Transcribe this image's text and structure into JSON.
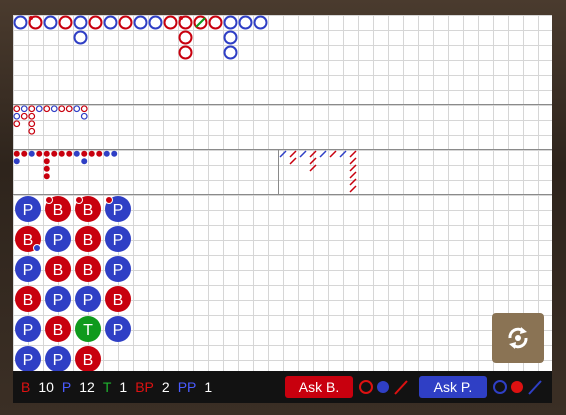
{
  "colors": {
    "banker": "#c8000e",
    "player": "#2f3fc5",
    "tie": "#0f9a1d",
    "grid": "#d6d6d6",
    "divider": "#8a8a8a"
  },
  "bead_plate": {
    "columns": [
      [
        "P",
        "B",
        "P",
        "B",
        "P",
        "P"
      ],
      [
        "B",
        "P",
        "B",
        "P",
        "B",
        "P"
      ],
      [
        "B",
        "B",
        "B",
        "P",
        "T",
        "B"
      ],
      [
        "P",
        "P",
        "P",
        "B",
        "P",
        null
      ]
    ],
    "markers": [
      {
        "col": 1,
        "row": 0,
        "type": "banker-pair"
      },
      {
        "col": 2,
        "row": 0,
        "type": "banker-pair"
      },
      {
        "col": 3,
        "row": 0,
        "type": "banker-pair"
      },
      {
        "col": 0,
        "row": 1,
        "type": "player-pair"
      }
    ]
  },
  "big_road": {
    "entries": [
      {
        "col": 0,
        "row": 0,
        "c": "P"
      },
      {
        "col": 1,
        "row": 0,
        "c": "B"
      },
      {
        "col": 2,
        "row": 0,
        "c": "P"
      },
      {
        "col": 3,
        "row": 0,
        "c": "B"
      },
      {
        "col": 4,
        "row": 0,
        "c": "P"
      },
      {
        "col": 4,
        "row": 1,
        "c": "P"
      },
      {
        "col": 5,
        "row": 0,
        "c": "B"
      },
      {
        "col": 6,
        "row": 0,
        "c": "P"
      },
      {
        "col": 7,
        "row": 0,
        "c": "B"
      },
      {
        "col": 8,
        "row": 0,
        "c": "P"
      },
      {
        "col": 9,
        "row": 0,
        "c": "P"
      },
      {
        "col": 10,
        "row": 0,
        "c": "B"
      },
      {
        "col": 11,
        "row": 0,
        "c": "B"
      },
      {
        "col": 11,
        "row": 1,
        "c": "B"
      },
      {
        "col": 11,
        "row": 2,
        "c": "B"
      },
      {
        "col": 12,
        "row": 0,
        "c": "B"
      },
      {
        "col": 13,
        "row": 0,
        "c": "B"
      },
      {
        "col": 14,
        "row": 0,
        "c": "P"
      },
      {
        "col": 14,
        "row": 1,
        "c": "P"
      },
      {
        "col": 14,
        "row": 2,
        "c": "P"
      },
      {
        "col": 15,
        "row": 0,
        "c": "P"
      },
      {
        "col": 16,
        "row": 0,
        "c": "P"
      }
    ],
    "ties": [
      {
        "col": 12,
        "row": 0
      }
    ],
    "markers": [
      {
        "col": 1,
        "row": 0,
        "type": "banker-pair"
      },
      {
        "col": 11,
        "row": 0,
        "type": "banker-pair"
      }
    ]
  },
  "big_eye_road": {
    "entries": [
      {
        "col": 0,
        "row": 0,
        "c": "B"
      },
      {
        "col": 0,
        "row": 1,
        "c": "P"
      },
      {
        "col": 0,
        "row": 2,
        "c": "B"
      },
      {
        "col": 1,
        "row": 0,
        "c": "P"
      },
      {
        "col": 1,
        "row": 1,
        "c": "B"
      },
      {
        "col": 2,
        "row": 0,
        "c": "B"
      },
      {
        "col": 2,
        "row": 1,
        "c": "B"
      },
      {
        "col": 2,
        "row": 2,
        "c": "B"
      },
      {
        "col": 2,
        "row": 3,
        "c": "B"
      },
      {
        "col": 3,
        "row": 0,
        "c": "P"
      },
      {
        "col": 4,
        "row": 0,
        "c": "B"
      },
      {
        "col": 5,
        "row": 0,
        "c": "P"
      },
      {
        "col": 6,
        "row": 0,
        "c": "B"
      },
      {
        "col": 7,
        "row": 0,
        "c": "B"
      },
      {
        "col": 8,
        "row": 0,
        "c": "P"
      },
      {
        "col": 9,
        "row": 0,
        "c": "B"
      },
      {
        "col": 9,
        "row": 1,
        "c": "P"
      }
    ]
  },
  "small_road": {
    "entries": [
      {
        "col": 0,
        "row": 0,
        "c": "B"
      },
      {
        "col": 0,
        "row": 1,
        "c": "P"
      },
      {
        "col": 1,
        "row": 0,
        "c": "B"
      },
      {
        "col": 2,
        "row": 0,
        "c": "P"
      },
      {
        "col": 3,
        "row": 0,
        "c": "B"
      },
      {
        "col": 4,
        "row": 0,
        "c": "B"
      },
      {
        "col": 4,
        "row": 1,
        "c": "B"
      },
      {
        "col": 4,
        "row": 2,
        "c": "B"
      },
      {
        "col": 4,
        "row": 3,
        "c": "B"
      },
      {
        "col": 5,
        "row": 0,
        "c": "B"
      },
      {
        "col": 6,
        "row": 0,
        "c": "B"
      },
      {
        "col": 7,
        "row": 0,
        "c": "B"
      },
      {
        "col": 8,
        "row": 0,
        "c": "P"
      },
      {
        "col": 9,
        "row": 0,
        "c": "B"
      },
      {
        "col": 9,
        "row": 1,
        "c": "P"
      },
      {
        "col": 10,
        "row": 0,
        "c": "B"
      },
      {
        "col": 11,
        "row": 0,
        "c": "B"
      },
      {
        "col": 12,
        "row": 0,
        "c": "P"
      },
      {
        "col": 13,
        "row": 0,
        "c": "P"
      }
    ]
  },
  "cockroach_road": {
    "entries": [
      {
        "col": 0,
        "row": 0,
        "c": "P"
      },
      {
        "col": 1,
        "row": 0,
        "c": "B"
      },
      {
        "col": 1,
        "row": 1,
        "c": "B"
      },
      {
        "col": 2,
        "row": 0,
        "c": "P"
      },
      {
        "col": 3,
        "row": 0,
        "c": "B"
      },
      {
        "col": 3,
        "row": 1,
        "c": "B"
      },
      {
        "col": 3,
        "row": 2,
        "c": "B"
      },
      {
        "col": 4,
        "row": 0,
        "c": "P"
      },
      {
        "col": 5,
        "row": 0,
        "c": "B"
      },
      {
        "col": 6,
        "row": 0,
        "c": "P"
      },
      {
        "col": 7,
        "row": 0,
        "c": "B"
      },
      {
        "col": 7,
        "row": 1,
        "c": "B"
      },
      {
        "col": 7,
        "row": 2,
        "c": "B"
      },
      {
        "col": 7,
        "row": 3,
        "c": "B"
      },
      {
        "col": 7,
        "row": 4,
        "c": "B"
      },
      {
        "col": 7,
        "row": 5,
        "c": "B"
      }
    ]
  },
  "stats": {
    "banker_label": "B",
    "banker_count": "10",
    "player_label": "P",
    "player_count": "12",
    "tie_label": "T",
    "tie_count": "1",
    "banker_pair_label": "BP",
    "banker_pair_count": "2",
    "player_pair_label": "PP",
    "player_pair_count": "1"
  },
  "ask_banker_label": "Ask B.",
  "ask_player_label": "Ask P.",
  "icons": {
    "shuffle": "shuffle-icon"
  }
}
